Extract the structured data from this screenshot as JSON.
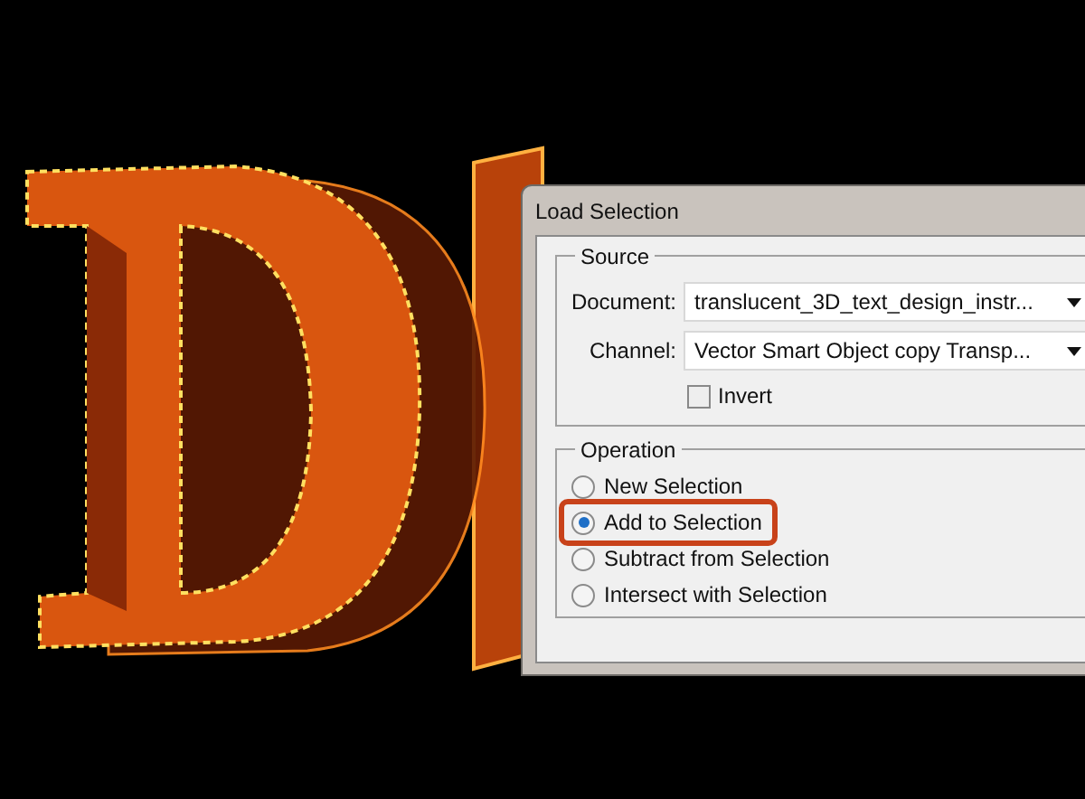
{
  "dialog": {
    "title": "Load Selection",
    "source": {
      "legend": "Source",
      "document": {
        "label": "Document:",
        "value": "translucent_3D_text_design_instr..."
      },
      "channel": {
        "label": "Channel:",
        "value": "Vector Smart Object copy Transp..."
      },
      "invert": {
        "label": "Invert",
        "checked": false
      }
    },
    "operation": {
      "legend": "Operation",
      "options": [
        {
          "label": "New Selection",
          "selected": false,
          "highlighted": false
        },
        {
          "label": "Add to Selection",
          "selected": true,
          "highlighted": true
        },
        {
          "label": "Subtract from Selection",
          "selected": false,
          "highlighted": false
        },
        {
          "label": "Intersect with Selection",
          "selected": false,
          "highlighted": false
        }
      ]
    }
  }
}
